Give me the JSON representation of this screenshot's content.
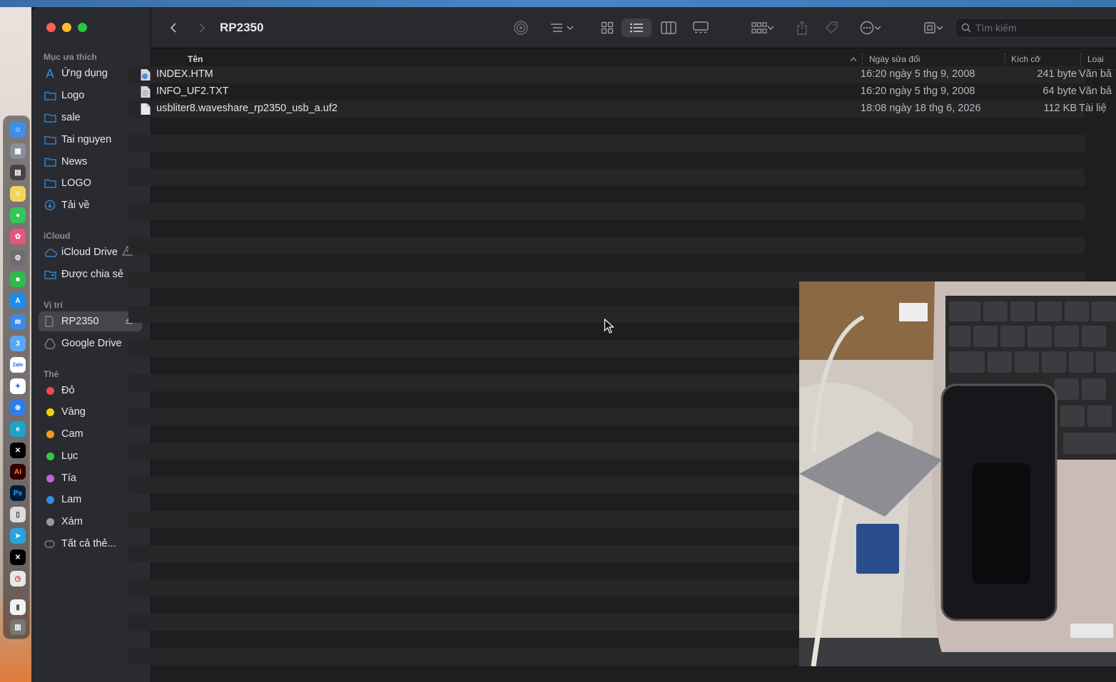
{
  "window": {
    "title": "RP2350"
  },
  "toolbar": {
    "search_placeholder": "Tìm kiếm"
  },
  "sidebar": {
    "favorites_title": "Mục ưa thích",
    "favorites": [
      "Ứng dụng",
      "Logo",
      "sale",
      "Tai nguyen",
      "News",
      "LOGO",
      "Tải về"
    ],
    "icloud_title": "iCloud",
    "icloud": [
      "iCloud Drive",
      "Được chia sẻ"
    ],
    "locations_title": "Vị trí",
    "locations": [
      "RP2350",
      "Google Drive"
    ],
    "tags_title": "Thẻ",
    "tags": [
      {
        "label": "Đỏ",
        "color": "#ee4b4b"
      },
      {
        "label": "Vàng",
        "color": "#f2d00e"
      },
      {
        "label": "Cam",
        "color": "#f29a1b"
      },
      {
        "label": "Lục",
        "color": "#33c84a"
      },
      {
        "label": "Tía",
        "color": "#c361e0"
      },
      {
        "label": "Lam",
        "color": "#2f8fe8"
      },
      {
        "label": "Xám",
        "color": "#9a9a9e"
      }
    ],
    "all_tags": "Tất cả thẻ..."
  },
  "columns": {
    "name": "Tên",
    "modified": "Ngày sửa đổi",
    "size": "Kích cỡ",
    "kind": "Loại"
  },
  "files": [
    {
      "name": "INDEX.HTM",
      "modified": "16:20 ngày 5 thg 9, 2008",
      "size": "241 byte",
      "kind": "Văn bả",
      "icon": "html-file-icon"
    },
    {
      "name": "INFO_UF2.TXT",
      "modified": "16:20 ngày 5 thg 9, 2008",
      "size": "64 byte",
      "kind": "Văn bả",
      "icon": "text-file-icon"
    },
    {
      "name": "usbliter8.waveshare_rp2350_usb_a.uf2",
      "modified": "18:08 ngày 18 thg 6, 2026",
      "size": "112 KB",
      "kind": "Tài liệ",
      "icon": "document-file-icon"
    }
  ],
  "colors": {
    "accent": "#2f8fe8",
    "window_bg": "#1e1e20",
    "sidebar_bg": "#2a2b30"
  }
}
